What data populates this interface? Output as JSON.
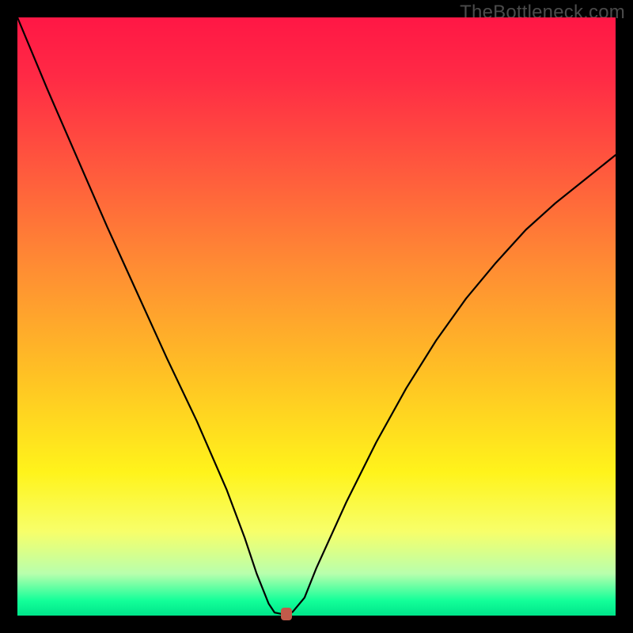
{
  "watermark": "TheBottleneck.com",
  "chart_data": {
    "type": "line",
    "title": "",
    "xlabel": "",
    "ylabel": "",
    "xlim": [
      0,
      100
    ],
    "ylim": [
      0,
      100
    ],
    "grid": false,
    "series": [
      {
        "name": "bottleneck-curve",
        "x": [
          0,
          5,
          10,
          15,
          20,
          25,
          30,
          35,
          38,
          40,
          42,
          43,
          44,
          45,
          46,
          48,
          50,
          55,
          60,
          65,
          70,
          75,
          80,
          85,
          90,
          95,
          100
        ],
        "values": [
          100,
          88,
          76.5,
          65,
          54,
          43,
          32.5,
          21,
          13,
          7,
          2,
          0.5,
          0.3,
          0.3,
          0.6,
          3,
          8,
          19,
          29,
          38,
          46,
          53,
          59,
          64.5,
          69,
          73,
          77
        ]
      }
    ],
    "marker": {
      "x": 45,
      "y": 0.3,
      "color": "#c25a4a"
    },
    "gradient_stops": [
      {
        "pos": 0.0,
        "color": "#ff1745"
      },
      {
        "pos": 0.1,
        "color": "#ff2a45"
      },
      {
        "pos": 0.26,
        "color": "#ff5b3d"
      },
      {
        "pos": 0.42,
        "color": "#ff8d33"
      },
      {
        "pos": 0.6,
        "color": "#ffc224"
      },
      {
        "pos": 0.76,
        "color": "#fff31b"
      },
      {
        "pos": 0.86,
        "color": "#f7ff6a"
      },
      {
        "pos": 0.93,
        "color": "#b8ffad"
      },
      {
        "pos": 0.975,
        "color": "#13ff99"
      },
      {
        "pos": 1.0,
        "color": "#00e58a"
      }
    ]
  }
}
